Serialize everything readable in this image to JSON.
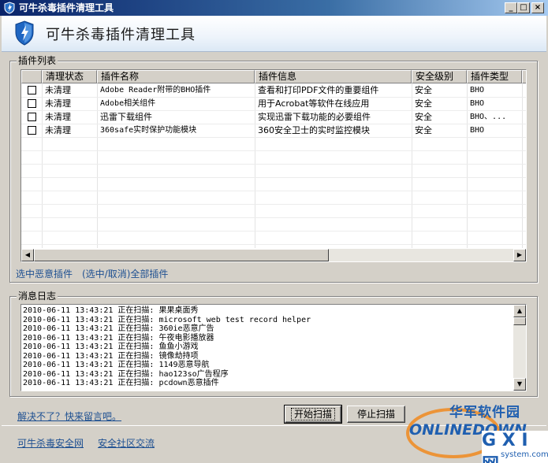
{
  "window": {
    "title": "可牛杀毒插件清理工具",
    "minimize": "_",
    "maximize": "□",
    "close": "×"
  },
  "header": {
    "title": "可牛杀毒插件清理工具"
  },
  "plugin_list": {
    "legend": "插件列表",
    "columns": [
      "清理状态",
      "插件名称",
      "插件信息",
      "安全级别",
      "插件类型"
    ],
    "rows": [
      {
        "checked": false,
        "status": "未清理",
        "name": "Adobe Reader附带的BHO插件",
        "info": "查看和打印PDF文件的重要组件",
        "level": "安全",
        "type": "BHO"
      },
      {
        "checked": false,
        "status": "未清理",
        "name": "Adobe相关组件",
        "info": "用于Acrobat等软件在线应用",
        "level": "安全",
        "type": "BHO"
      },
      {
        "checked": false,
        "status": "未清理",
        "name": "迅雷下载组件",
        "info": "实现迅雷下载功能的必要组件",
        "level": "安全",
        "type": "BHO、..."
      },
      {
        "checked": false,
        "status": "未清理",
        "name": "360safe实时保护功能模块",
        "info": "360安全卫士的实时监控模块",
        "level": "安全",
        "type": "BHO"
      }
    ],
    "select_malicious": "选中恶意插件",
    "toggle_all": "(选中/取消)全部插件"
  },
  "log": {
    "legend": "消息日志",
    "lines": [
      "2010-06-11 13:43:21 正在扫描: 果果桌面秀",
      "2010-06-11 13:43:21 正在扫描: microsoft web test record helper",
      "2010-06-11 13:43:21 正在扫描: 360ie恶意广告",
      "2010-06-11 13:43:21 正在扫描: 午夜电影播放器",
      "2010-06-11 13:43:21 正在扫描: 鱼鱼小游戏",
      "2010-06-11 13:43:21 正在扫描: 镜像劫持项",
      "2010-06-11 13:43:21 正在扫描: 1149恶意导航",
      "2010-06-11 13:43:21 正在扫描: hao123so广告程序",
      "2010-06-11 13:43:21 正在扫描: pcdown恶意插件"
    ]
  },
  "actions": {
    "help_link": "解决不了？快来留言吧。",
    "start_scan": "开始扫描",
    "stop_scan": "停止扫描"
  },
  "footer": {
    "site_link": "可牛杀毒安全网",
    "community_link": "安全社区交流"
  },
  "watermark": {
    "brand_cn": "华军软件园",
    "brand_en": "ONLINEDOWN",
    "gxi": "G X I 网",
    "domain": "system.com"
  },
  "colors": {
    "title_start": "#0a246a",
    "title_end": "#a6caf0",
    "link": "#1d4f91",
    "face": "#d4d0c8",
    "watermark_orange": "#f0891f",
    "watermark_blue": "#1f5fb0"
  }
}
